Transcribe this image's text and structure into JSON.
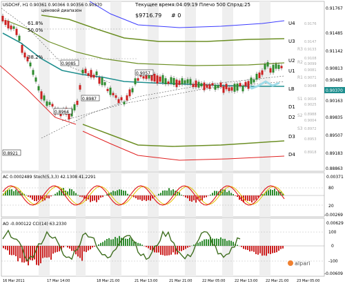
{
  "header": {
    "symbol_line": "USDCHF, H1  0.90361 0.90366 0.90356 0.90370",
    "price_range_label": "ценовой диапазон",
    "server_time": "Текущее время:04:09:19 Плечо 500 Спрэд:25",
    "balance": "$9716.79",
    "hash_zero": "# 0"
  },
  "fib_labels": [
    "61.8%",
    "50.0%",
    "38.2%"
  ],
  "levels": [
    {
      "name": "U4",
      "value": "0.9176"
    },
    {
      "name": "U3",
      "value": "0.9147"
    },
    {
      "name": "R3",
      "value": "0.9133"
    },
    {
      "name": "U2",
      "value": "0.9108"
    },
    {
      "name": "R2",
      "value": "0.9099"
    },
    {
      "name": "U1",
      "value": "0.9081"
    },
    {
      "name": "R1",
      "value": "0.9071"
    },
    {
      "name": "LB",
      "value": "0.9048"
    },
    {
      "name": "D1",
      "value": "0.9025"
    },
    {
      "name": "S1",
      "value": "0.9016"
    },
    {
      "name": "D2",
      "value": "0.9004"
    },
    {
      "name": "S2",
      "value": "0.8988"
    },
    {
      "name": "S3",
      "value": "0.8972"
    },
    {
      "name": "D3",
      "value": "0.8953"
    },
    {
      "name": "D4",
      "value": "0.8918"
    }
  ],
  "price_axis": [
    "0.91767",
    "0.91485",
    "0.91142",
    "0.90813",
    "0.90485",
    "0.90370",
    "0.90163",
    "0.89835",
    "0.89507",
    "0.89183",
    "0.88863"
  ],
  "current_price": "0.90370",
  "chart_price_labels": [
    "0.9085",
    "0.9057",
    "0.8987",
    "0.8964",
    "0.8921"
  ],
  "ac_stoch_label": "AC 0.0002489  Stoch(5,3,3) 42.1308 41.2291",
  "ac_axis": [
    "0.00371",
    "80",
    "20",
    "-0.00269"
  ],
  "ao_cci_label": "AO -0.000122  CCI(14) 63.2330",
  "ao_axis": [
    "0.00629",
    "100",
    "0",
    "-100",
    "-0.00609"
  ],
  "time_axis": [
    "16 Mar 2011",
    "17 Mar 14:00",
    "18 Mar 21:00",
    "21 Mar 13:00",
    "21 Mar 21:00",
    "22 Mar 05:00",
    "22 Mar 13:00",
    "22 Mar 21:00",
    "23 Mar 05:00"
  ],
  "watermark": "alpari",
  "colors": {
    "up": "#2e8b2e",
    "down": "#cc2020",
    "teal": "#1f8f8f",
    "olive": "#6b8e23",
    "blue": "#3a3aff",
    "red": "#e02020"
  }
}
